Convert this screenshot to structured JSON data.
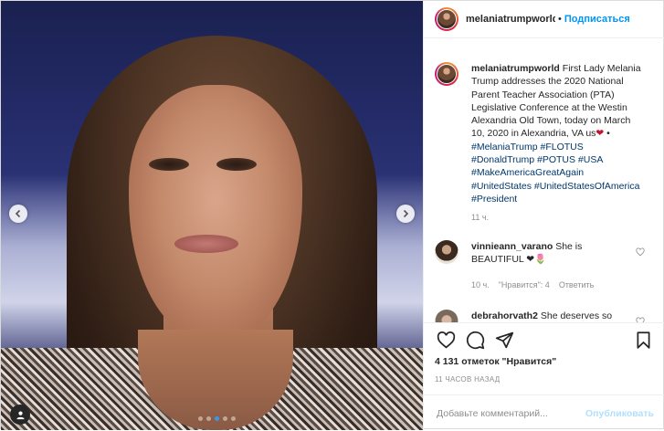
{
  "post": {
    "username": "melaniatrumpworld",
    "follow_label": "Подписаться",
    "separator": "•",
    "caption": {
      "username": "melaniatrumpworld",
      "text": "First Lady Melania Trump addresses the 2020 National Parent Teacher Association (PTA) Legislative Conference at the Westin Alexandria Old Town, today on March 10, 2020 in Alexandria, VA us",
      "heart": "❤",
      "bullet": " • ",
      "hashtags": [
        "#MelaniaTrump",
        "#FLOTUS",
        "#DonaldTrump",
        "#POTUS",
        "#USA",
        "#MakeAmericaGreatAgain",
        "#UnitedStates",
        "#UnitedStatesOfAmerica",
        "#President"
      ],
      "time": "11 ч."
    },
    "comments": [
      {
        "username": "vinnieann_varano",
        "text": "She is BEAUTIFUL ❤🌷",
        "time": "10 ч.",
        "likes": "\"Нравится\": 4",
        "reply": "Ответить"
      },
      {
        "username": "debrahorvath2",
        "text": "She deserves so",
        "time": "",
        "likes": "",
        "reply": ""
      }
    ],
    "likes_text": "4 131 отметок \"Нравится\"",
    "time_ago": "11 часов назад",
    "comment_placeholder": "Добавьте комментарий...",
    "publish_label": "Опубликовать",
    "carousel": {
      "slides": 5,
      "active": 2
    }
  },
  "icons": {
    "like": "heart-icon",
    "comment": "comment-icon",
    "share": "paper-plane-icon",
    "save": "bookmark-icon",
    "prev": "chevron-left-icon",
    "next": "chevron-right-icon",
    "tagged": "user-tag-icon"
  },
  "colors": {
    "accent": "#0095f6",
    "heart": "#c8102e",
    "hashtag": "#00376b",
    "muted": "#8e8e8e"
  }
}
